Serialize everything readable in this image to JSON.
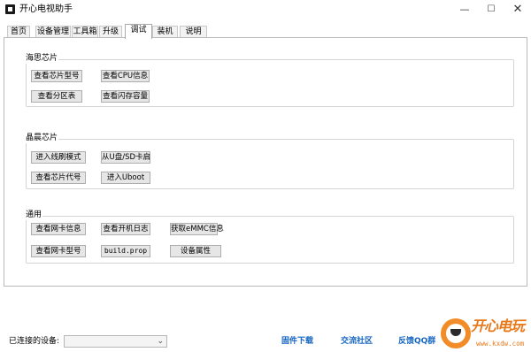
{
  "window": {
    "title": "开心电视助手",
    "minimize_glyph": "—",
    "maximize_glyph": "☐",
    "close_glyph": "✕"
  },
  "tabs": [
    {
      "label": "首页"
    },
    {
      "label": "设备管理"
    },
    {
      "label": "工具箱"
    },
    {
      "label": "升级"
    },
    {
      "label": "调试",
      "active": true
    },
    {
      "label": "装机"
    },
    {
      "label": "说明"
    }
  ],
  "groups": [
    {
      "title": "海思芯片",
      "buttons": [
        "查看芯片型号",
        "查看CPU信息",
        "查看分区表",
        "查看闪存容量"
      ]
    },
    {
      "title": "晶晨芯片",
      "buttons": [
        "进入线刷模式",
        "从U盘/SD卡启",
        "查看芯片代号",
        "进入Uboot"
      ]
    },
    {
      "title": "通用",
      "buttons": [
        "查看网卡信息",
        "查看开机日志",
        "获取eMMC信息",
        "查看网卡型号",
        "build.prop",
        "设备属性"
      ]
    }
  ],
  "status": {
    "connected_label": "已连接的设备:",
    "device_value": "",
    "chevron_glyph": "⌄"
  },
  "links": {
    "firmware": "固件下载",
    "community": "交流社区",
    "qq": "反馈QQ群"
  },
  "logo": {
    "text": "开心电玩",
    "domain": "www.kxdw.com"
  },
  "colors": {
    "link": "#1565c0",
    "logo_orange": "#e8781a",
    "button_face": "#e6e6e6"
  }
}
